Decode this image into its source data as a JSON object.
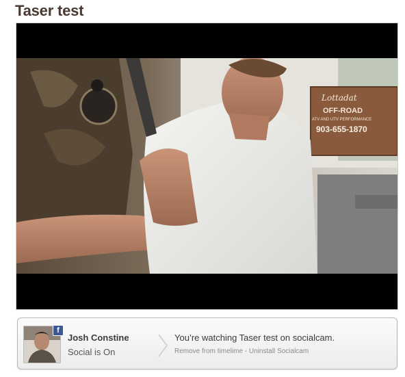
{
  "page": {
    "title": "Taser test"
  },
  "activity": {
    "user_name": "Josh Constine",
    "social_status": "Social is On",
    "message": "You’re watching Taser test on socialcam.",
    "remove_link": "Remove from timelime",
    "separator": " - ",
    "uninstall_link": "Uninstall Socialcam",
    "badge_label": "f"
  },
  "video": {
    "sign_line1": "OFF-ROAD",
    "sign_line2": "ATV AND UTV PERFORMANCE",
    "sign_phone": "903-655-1870",
    "sign_brand": "Lottadat"
  },
  "colors": {
    "title": "#4a3a32",
    "facebook": "#3b5998",
    "player_bg": "#000000"
  }
}
